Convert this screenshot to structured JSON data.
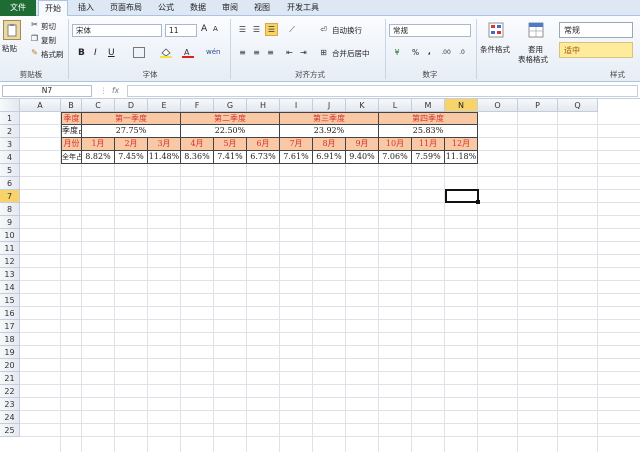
{
  "tabs": [
    "文件",
    "开始",
    "插入",
    "页面布局",
    "公式",
    "数据",
    "审阅",
    "视图",
    "开发工具"
  ],
  "clipboard": {
    "paste": "粘贴",
    "cut": "剪切",
    "copy": "复制",
    "painter": "格式刷",
    "label": "剪贴板"
  },
  "font": {
    "name": "宋体",
    "size": "11",
    "grow": "A",
    "shrink": "A",
    "bold": "B",
    "italic": "I",
    "underline": "U",
    "label": "字体",
    "wen": "wén"
  },
  "align": {
    "wrap": "自动换行",
    "merge": "合并后居中",
    "label": "对齐方式"
  },
  "number": {
    "format": "常规",
    "pct": "%",
    "comma": ",",
    "label": "数字"
  },
  "styles": {
    "cond": "条件格式",
    "table1": "套用",
    "table2": "表格格式",
    "normal": "常规",
    "neutral": "适中",
    "label": "样式"
  },
  "namebox": "N7",
  "fx": "fx",
  "colors": {
    "file_tab": "#1e6b33",
    "header_fill": "#f9c9a5",
    "header_text": "#d4332b",
    "selected_header": "#f7d36a"
  },
  "columns": [
    "A",
    "B",
    "C",
    "D",
    "E",
    "F",
    "G",
    "H",
    "I",
    "J",
    "K",
    "L",
    "M",
    "N",
    "O",
    "P",
    "Q"
  ],
  "rows": [
    "1",
    "2",
    "3",
    "4",
    "5",
    "6",
    "7",
    "8",
    "9",
    "10",
    "11",
    "12",
    "13",
    "14",
    "15",
    "16",
    "17",
    "18",
    "19",
    "20",
    "21",
    "22",
    "23",
    "24",
    "25"
  ],
  "sheet": {
    "r1": {
      "b": "季度",
      "q1": "第一季度",
      "q2": "第二季度",
      "q3": "第三季度",
      "q4": "第四季度"
    },
    "r2": {
      "b": "季度占比",
      "q1": "27.75%",
      "q2": "22.50%",
      "q3": "23.92%",
      "q4": "25.83%"
    },
    "r3": {
      "b": "月份",
      "months": [
        "1月",
        "2月",
        "3月",
        "4月",
        "5月",
        "6月",
        "7月",
        "8月",
        "9月",
        "10月",
        "11月",
        "12月"
      ]
    },
    "r4": {
      "b": "全年占比",
      "values": [
        "8.82%",
        "7.45%",
        "11.48%",
        "8.36%",
        "7.41%",
        "6.73%",
        "7.61%",
        "6.91%",
        "9.40%",
        "7.06%",
        "7.59%",
        "11.18%"
      ]
    }
  }
}
